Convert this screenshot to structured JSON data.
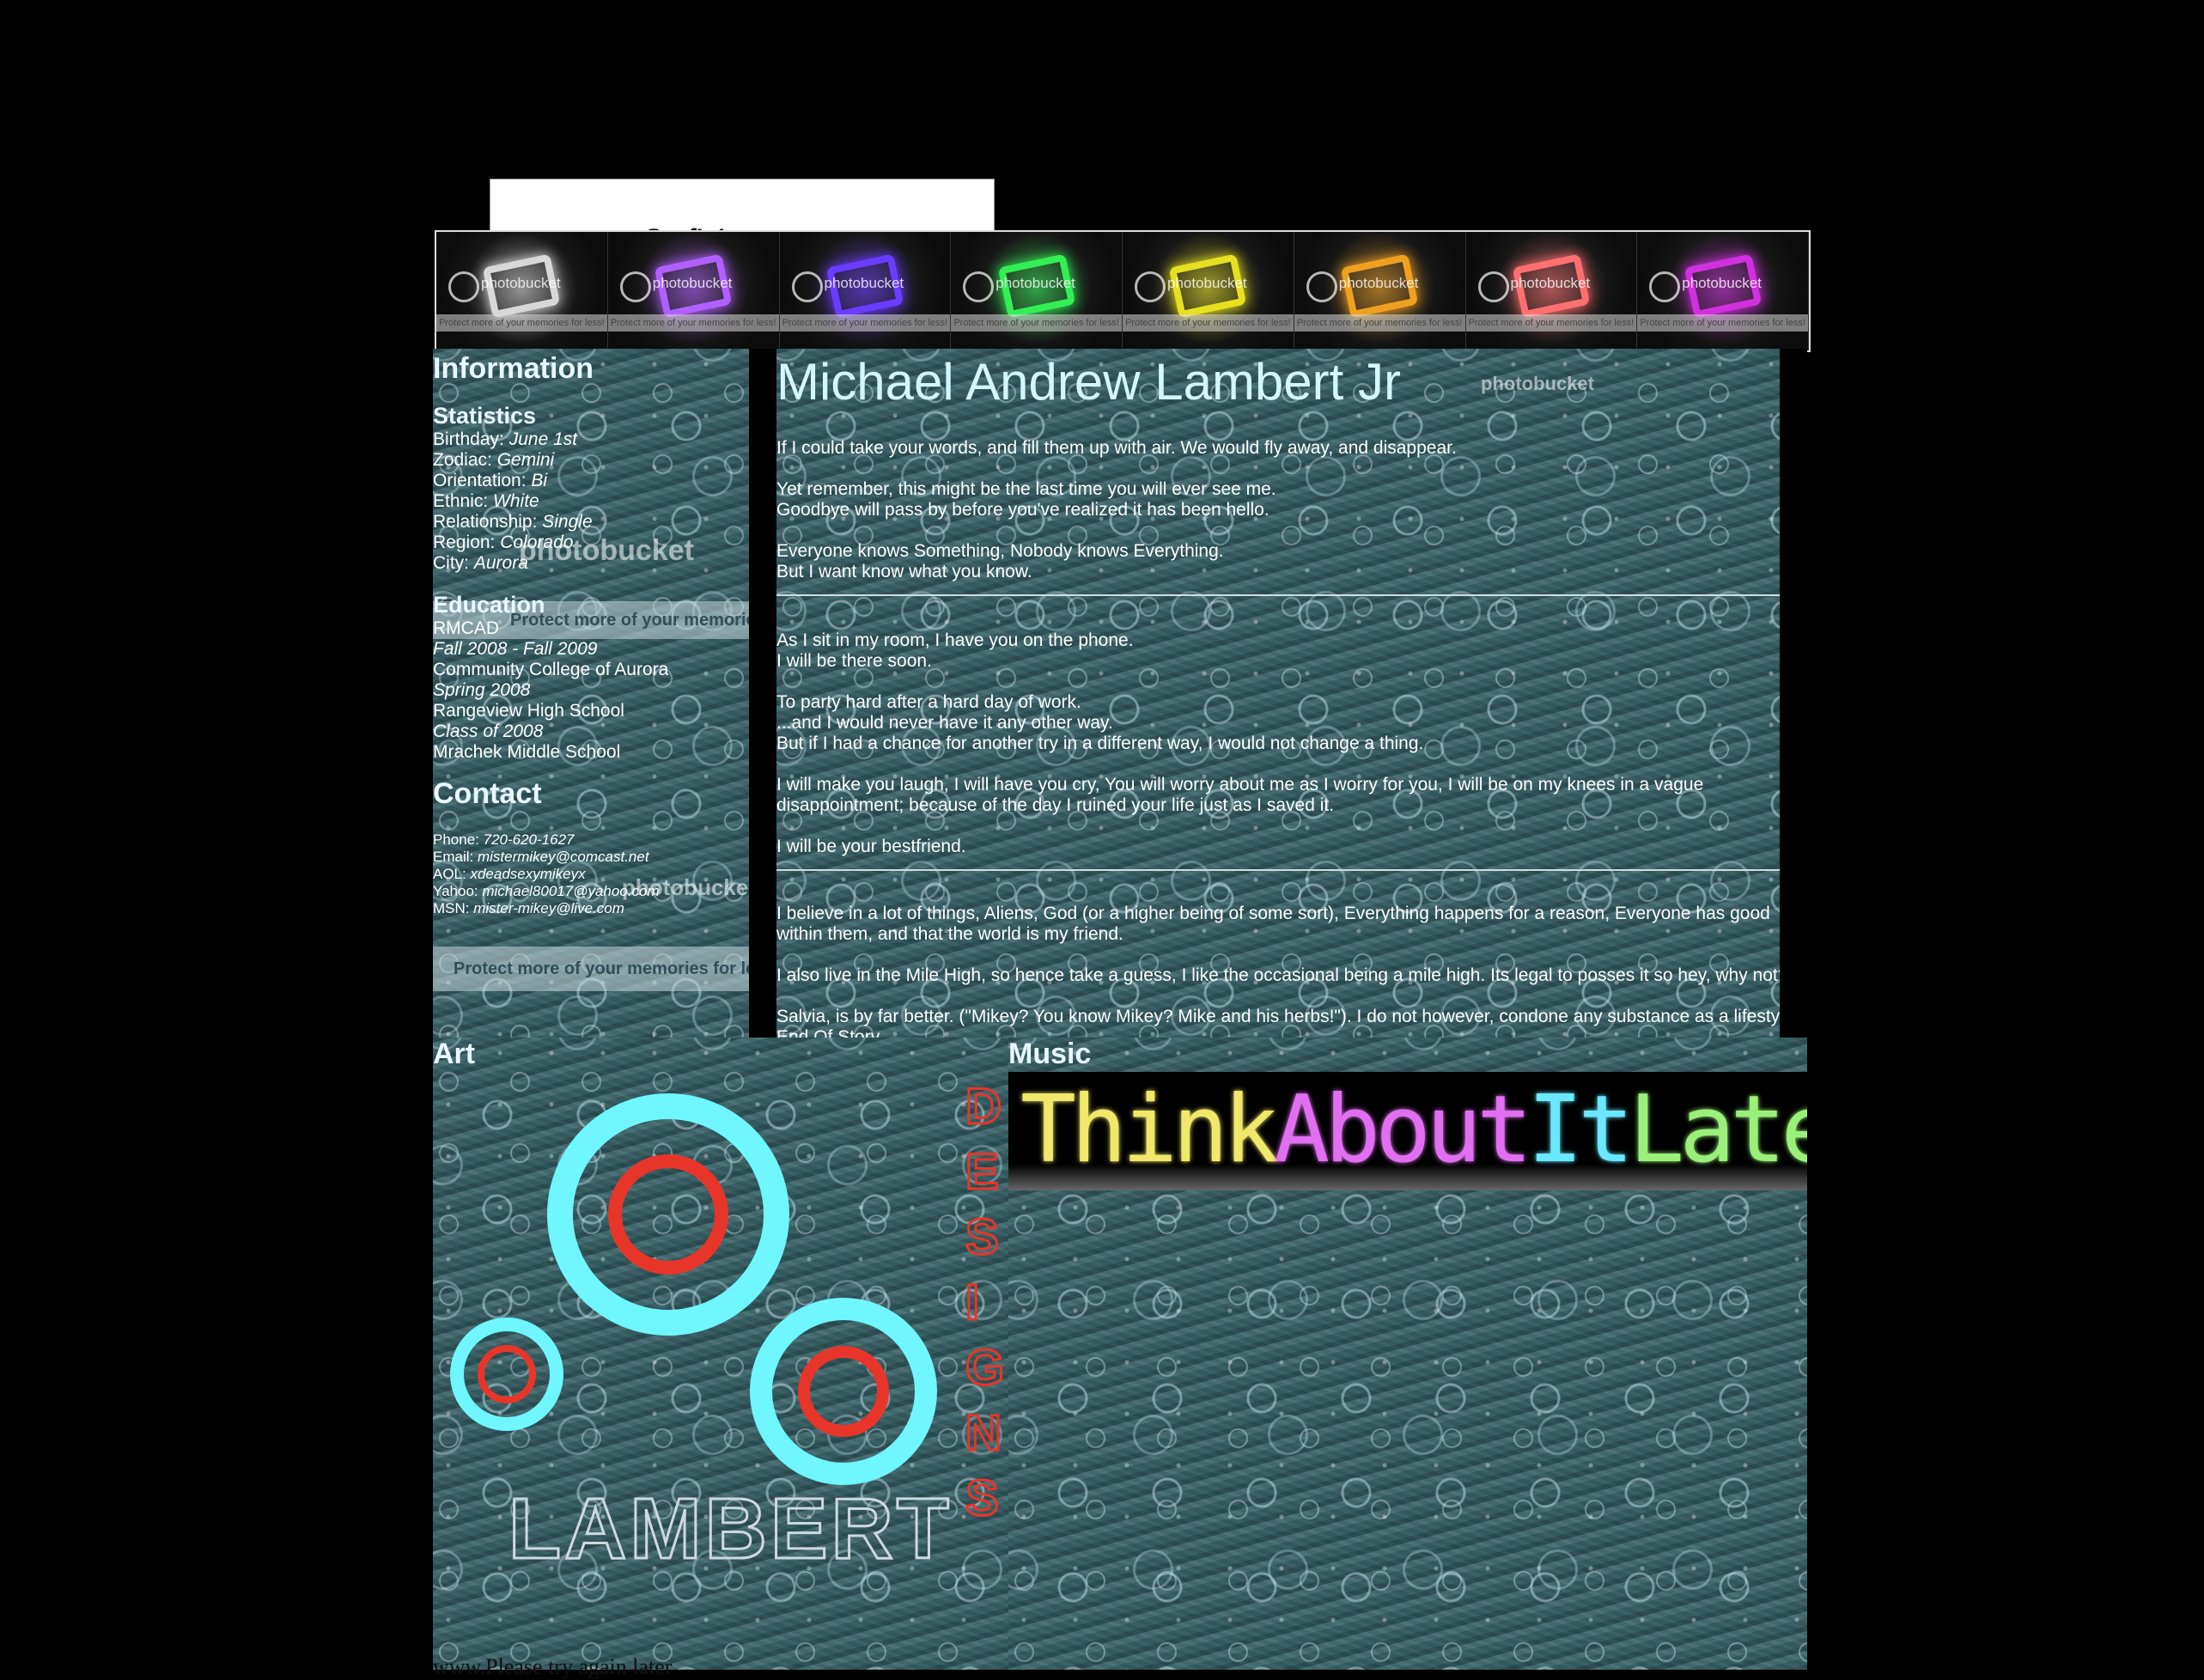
{
  "top_tab": {
    "text": "Surf'n' ...."
  },
  "banner": {
    "watermark": "photobucket",
    "strip": "Protect more of your memories for less!",
    "tiles": [
      {
        "color": "#d8d8d8",
        "icon": "home-icon"
      },
      {
        "color": "#b060ff",
        "icon": "edit-icon"
      },
      {
        "color": "#6a3cff",
        "icon": "add-friend-icon"
      },
      {
        "color": "#33ee55",
        "icon": "frame-icon"
      },
      {
        "color": "#e6e020",
        "icon": "speech-bubble-icon"
      },
      {
        "color": "#f0a020",
        "icon": "photo-icon"
      },
      {
        "color": "#ff7070",
        "icon": "blog-icon"
      },
      {
        "color": "#d030e0",
        "icon": "music-icon"
      }
    ]
  },
  "info": {
    "heading": "Information",
    "statistics": {
      "heading": "Statistics",
      "rows": [
        {
          "label": "Birthday: ",
          "value": "June 1st"
        },
        {
          "label": "Zodiac: ",
          "value": "Gemini"
        },
        {
          "label": "Orientation: ",
          "value": "Bi"
        },
        {
          "label": "Ethnic: ",
          "value": "White"
        },
        {
          "label": "Relationship: ",
          "value": "Single"
        },
        {
          "label": "Region: ",
          "value": "Colorado"
        },
        {
          "label": "City: ",
          "value": "Aurora"
        }
      ]
    },
    "education": {
      "heading": "Education",
      "rows": [
        {
          "school": "RMCAD",
          "dates": "Fall 2008 - Fall 2009"
        },
        {
          "school": "Community College of Aurora",
          "dates": "Spring 2008"
        },
        {
          "school": "Rangeview High School",
          "dates": "Class of 2008"
        },
        {
          "school": "Mrachek Middle School",
          "dates": ""
        }
      ]
    },
    "contact": {
      "heading": "Contact",
      "rows": [
        {
          "label": "Phone: ",
          "value": "720-620-1627"
        },
        {
          "label": "Email: ",
          "value": "mistermikey@comcast.net"
        },
        {
          "label": "AOL: ",
          "value": "xdeadsexymikeyx"
        },
        {
          "label": "Yahoo: ",
          "value": "michael80017@yahoo.com"
        },
        {
          "label": "MSN: ",
          "value": "mister-mikey@live.com"
        }
      ]
    },
    "watermark": "photobucket",
    "protect_text": "Protect more of your memories for less!"
  },
  "about": {
    "title": "Michael Andrew Lambert Jr",
    "paragraphs": [
      "If I could take your words, and fill them up with air. We would fly away, and disappear.",
      "Yet remember, this might be the last time you will ever see me.",
      "Goodbye will pass by before you've realized it has been hello.",
      "Everyone knows Something, Nobody knows Everything.",
      "But I want know what you know.",
      "As I sit in my room, I have you on the phone.",
      "I will be there soon.",
      "To party hard after a hard day of work.",
      "...and I would never have it any other way.",
      "But if I had a chance for another try in a different way, I would not change a thing.",
      "I will make you laugh, I will have you cry, You will worry about me as I worry for you, I will be on my knees in a vague disappointment; because of the day I ruined your life just as I saved it.",
      "I will be your bestfriend.",
      "I believe in a lot of things, Aliens, God (or a higher being of some sort), Everything happens for a reason, Everyone has good within them, and that the world is my friend.",
      "I also live in the Mile High, so hence take a guess, I like the occasional being a mile high. Its legal to posses it so hey, why not?",
      "Salvia, is by far better. (\"Mikey? You know Mikey? Mike and his herbs!\"). I do not however, condone any substance as a lifestyle. End Of Story."
    ],
    "watermark": "photobucket"
  },
  "art": {
    "heading": "Art",
    "logo_word": "LAMBERT",
    "logo_vertical": "DESIGNS"
  },
  "music": {
    "heading": "Music",
    "banner_words": [
      {
        "text": "Think",
        "color": "#f0e86a"
      },
      {
        "text": "About",
        "color": "#e070f0"
      },
      {
        "text": "It",
        "color": "#6ae8ff"
      },
      {
        "text": "Later",
        "color": "#9af07a"
      }
    ]
  },
  "footer": {
    "text": "www.Please try again later"
  }
}
